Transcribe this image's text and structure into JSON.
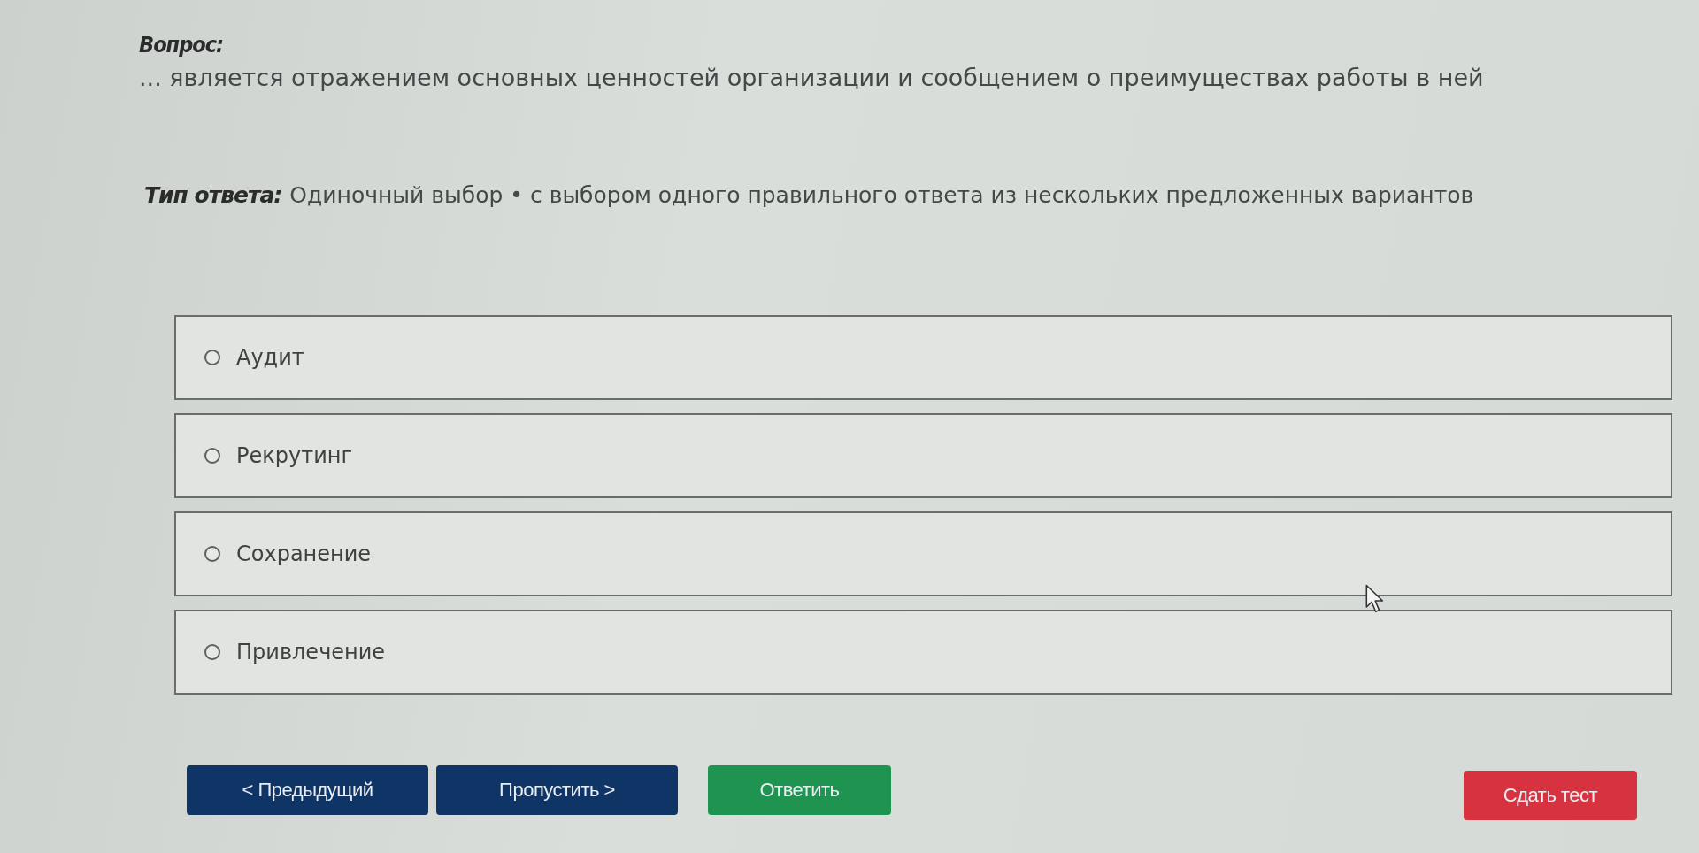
{
  "question": {
    "label": "Вопрос:",
    "text": "... является отражением основных ценностей организации и сообщением о преимуществах работы в ней"
  },
  "answer_type": {
    "label": "Тип ответа:",
    "value": "Одиночный выбор • с выбором одного правильного ответа из нескольких предложенных вариантов"
  },
  "options": [
    {
      "label": "Аудит",
      "selected": false
    },
    {
      "label": "Рекрутинг",
      "selected": false
    },
    {
      "label": "Сохранение",
      "selected": false
    },
    {
      "label": "Привлечение",
      "selected": false
    }
  ],
  "buttons": [
    {
      "label": "< Предыдущий",
      "kind": "nav"
    },
    {
      "label": "Пропустить >",
      "kind": "nav"
    },
    {
      "label": "Ответить",
      "kind": "answer"
    },
    {
      "label": "Сдать тест",
      "kind": "finish"
    }
  ]
}
